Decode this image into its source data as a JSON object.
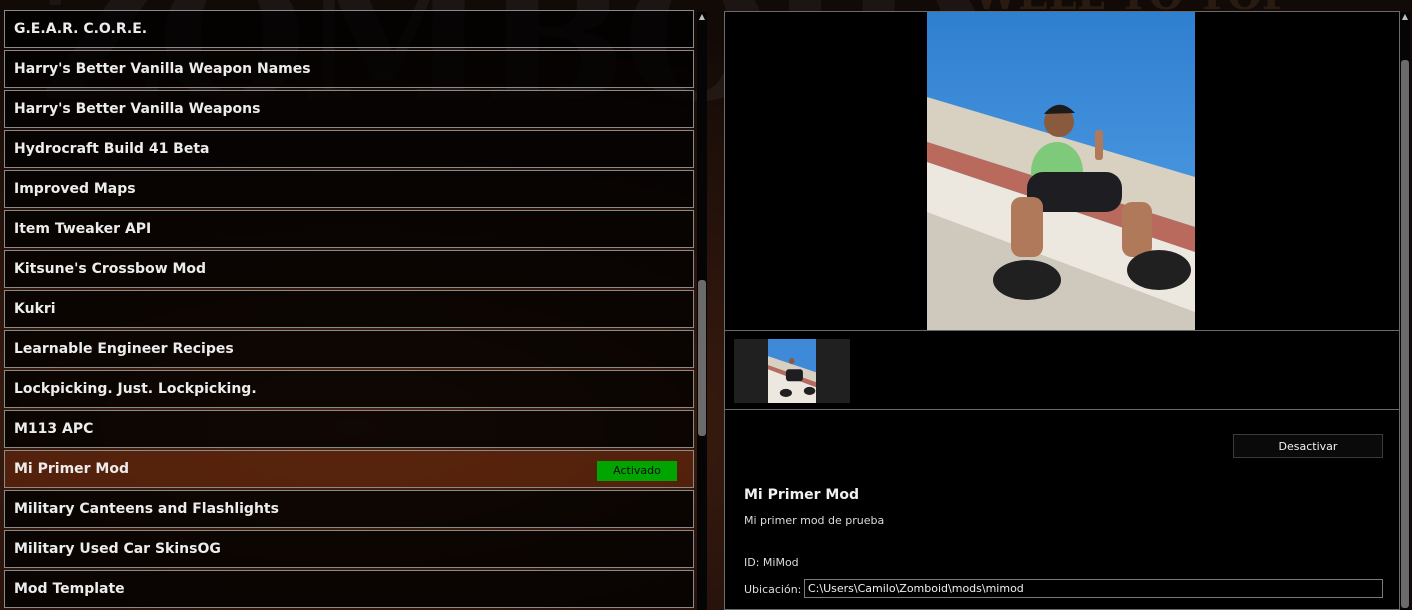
{
  "mods": [
    {
      "name": "G.E.A.R. C.O.R.E.",
      "selected": false
    },
    {
      "name": "Harry's Better Vanilla Weapon Names",
      "selected": false
    },
    {
      "name": "Harry's Better Vanilla Weapons",
      "selected": false
    },
    {
      "name": "Hydrocraft Build 41 Beta",
      "selected": false
    },
    {
      "name": "Improved Maps",
      "selected": false
    },
    {
      "name": "Item Tweaker API",
      "selected": false
    },
    {
      "name": "Kitsune's Crossbow Mod",
      "selected": false
    },
    {
      "name": "Kukri",
      "selected": false
    },
    {
      "name": "Learnable Engineer Recipes",
      "selected": false
    },
    {
      "name": "Lockpicking. Just. Lockpicking.",
      "selected": false
    },
    {
      "name": "M113 APC",
      "selected": false
    },
    {
      "name": "Mi Primer Mod",
      "selected": true,
      "status": "Activado"
    },
    {
      "name": "Military Canteens and Flashlights",
      "selected": false
    },
    {
      "name": "Military Used Car SkinsOG",
      "selected": false
    },
    {
      "name": "Mod Template",
      "selected": false
    }
  ],
  "detail": {
    "deactivate_label": "Desactivar",
    "title": "Mi Primer Mod",
    "description": "Mi primer mod de prueba",
    "id_text": "ID: MiMod",
    "location_label": "Ubicación:",
    "location_value": "C:\\Users\\Camilo\\Zomboid\\mods\\mimod"
  },
  "colors": {
    "active_badge": "#00a500",
    "selected_row": "#5c240c",
    "border": "#8a8a8a"
  }
}
